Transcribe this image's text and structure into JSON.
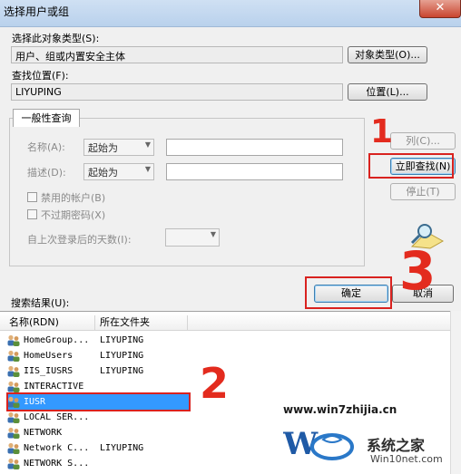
{
  "window": {
    "title": "选择用户或组",
    "close_glyph": "✕"
  },
  "object_type": {
    "label": "选择此对象类型(S):",
    "value": "用户、组或内置安全主体",
    "button": "对象类型(O)..."
  },
  "location": {
    "label": "查找位置(F):",
    "value": "LIYUPING",
    "button": "位置(L)..."
  },
  "query": {
    "tab": "一般性查询",
    "name_label": "名称(A):",
    "name_mode": "起始为",
    "desc_label": "描述(D):",
    "desc_mode": "起始为",
    "disabled_accounts": "禁用的帐户(B)",
    "no_expire_pwd": "不过期密码(X)",
    "days_label": "自上次登录后的天数(I):"
  },
  "side_buttons": {
    "columns": "列(C)...",
    "find_now": "立即查找(N)",
    "stop": "停止(T)"
  },
  "actions": {
    "ok": "确定",
    "cancel": "取消"
  },
  "results": {
    "label": "搜索结果(U):",
    "columns": [
      "名称(RDN)",
      "所在文件夹"
    ],
    "rows": [
      {
        "name": "HomeGroup...",
        "folder": "LIYUPING"
      },
      {
        "name": "HomeUsers",
        "folder": "LIYUPING"
      },
      {
        "name": "IIS_IUSRS",
        "folder": "LIYUPING"
      },
      {
        "name": "INTERACTIVE",
        "folder": ""
      },
      {
        "name": "IUSR",
        "folder": "",
        "selected": true
      },
      {
        "name": "LOCAL SER...",
        "folder": ""
      },
      {
        "name": "NETWORK",
        "folder": ""
      },
      {
        "name": "Network C...",
        "folder": "LIYUPING"
      },
      {
        "name": "NETWORK S...",
        "folder": ""
      }
    ]
  },
  "annotations": {
    "step1": "1",
    "step2": "2",
    "step3": "3"
  },
  "watermark": {
    "site1": "www.win7zhijia.cn",
    "brand": "系统之家",
    "site2": "Win10net.com"
  },
  "colors": {
    "selection": "#3399ff",
    "annotation": "#d9221f"
  }
}
